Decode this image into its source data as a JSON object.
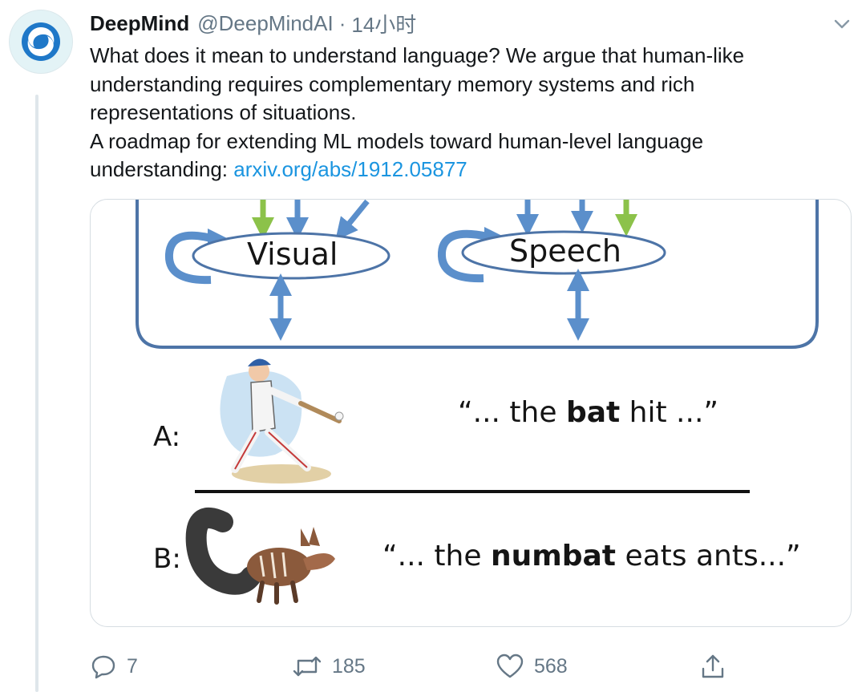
{
  "tweet": {
    "author_name": "DeepMind",
    "author_handle": "@DeepMindAI",
    "separator": "·",
    "timestamp": "14小时",
    "text_lines": [
      "What does it mean to understand language?  We argue that human-like",
      "understanding requires complementary memory systems and rich",
      "representations of situations.",
      "A roadmap for extending ML models toward human-level language"
    ],
    "text_last_prefix": "understanding: ",
    "link_text": "arxiv.org/abs/1912.05877"
  },
  "figure": {
    "visual_label": "Visual",
    "speech_label": "Speech",
    "row_a_label": "A:",
    "row_b_label": "B:",
    "quote_a": {
      "before": "“... the ",
      "bold": "bat",
      "after": " hit ...”"
    },
    "quote_b": {
      "before": "“... the ",
      "bold": "numbat",
      "after": " eats ants...”"
    }
  },
  "actions": {
    "replies": "7",
    "retweets": "185",
    "likes": "568"
  },
  "icons": [
    "caret-down-icon",
    "reply-icon",
    "retweet-icon",
    "like-icon",
    "share-icon"
  ],
  "colors": {
    "link": "#1b95e0",
    "muted": "#657786",
    "diagram_blue": "#5b8fcb",
    "diagram_green": "#8cc24a",
    "box_stroke": "#4d74a7"
  }
}
